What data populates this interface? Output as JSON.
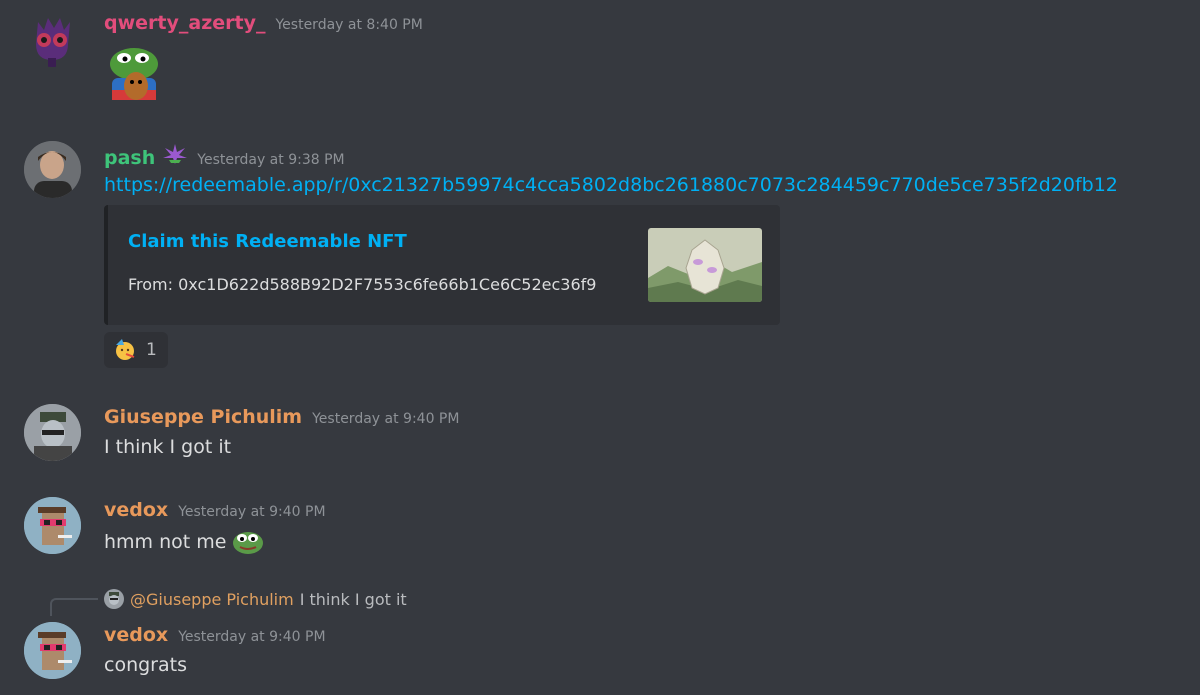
{
  "messages": [
    {
      "author": "qwerty_azerty_",
      "author_color": "#e24d7c",
      "time": "Yesterday at 8:40 PM"
    },
    {
      "author": "pash",
      "author_color": "#3ec47a",
      "time": "Yesterday at 9:38 PM",
      "link": "https://redeemable.app/r/0xc21327b59974c4cca5802d8bc261880c7073c284459c770de5ce735f2d20fb12",
      "embed": {
        "title": "Claim this Redeemable NFT",
        "description": "From: 0xc1D622d588B92D2F7553c6fe66b1Ce6C52ec36f9"
      },
      "reaction": {
        "emoji": "partying-face",
        "count": "1"
      }
    },
    {
      "author": "Giuseppe Pichulim",
      "author_color": "#e8995b",
      "time": "Yesterday at 9:40 PM",
      "text": "I think I got it"
    },
    {
      "author": "vedox",
      "author_color": "#e8995b",
      "time": "Yesterday at 9:40 PM",
      "text": "hmm not me"
    },
    {
      "author": "vedox",
      "author_color": "#e8995b",
      "time": "Yesterday at 9:40 PM",
      "text": "congrats",
      "reply": {
        "mention": "@Giuseppe Pichulim",
        "text": "I think I got it"
      }
    }
  ]
}
